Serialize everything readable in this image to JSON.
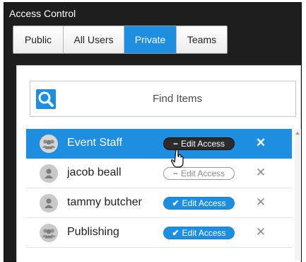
{
  "panel": {
    "title": "Access Control"
  },
  "tabs": [
    {
      "label": "Public",
      "active": false
    },
    {
      "label": "All Users",
      "active": false
    },
    {
      "label": "Private",
      "active": true
    },
    {
      "label": "Teams",
      "active": false
    }
  ],
  "search": {
    "placeholder": "Find Items",
    "icon": "search-icon"
  },
  "rows": [
    {
      "name": "Event Staff",
      "type": "group",
      "selected": true,
      "access_label": "Edit Access",
      "access_state": "remove",
      "access_glyph": "−"
    },
    {
      "name": "jacob beall",
      "type": "user",
      "selected": false,
      "access_label": "Edit Access",
      "access_state": "off",
      "access_glyph": "−"
    },
    {
      "name": "tammy butcher",
      "type": "user",
      "selected": false,
      "access_label": "Edit Access",
      "access_state": "on",
      "access_glyph": "✔"
    },
    {
      "name": "Publishing",
      "type": "group",
      "selected": false,
      "access_label": "Edit Access",
      "access_state": "on",
      "access_glyph": "✔"
    }
  ],
  "remove_glyph": "✕",
  "colors": {
    "accent": "#1e8fe0",
    "panel_bg": "#1e1e1e",
    "dark_pill": "#2b2b2b"
  }
}
